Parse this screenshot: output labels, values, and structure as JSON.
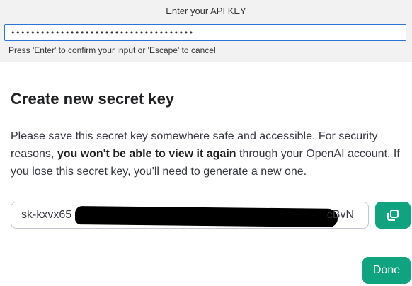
{
  "prompt": {
    "title": "Enter your API KEY",
    "input_value": "•••••••••••••••••••••••••••••••••••••",
    "hint": "Press 'Enter' to confirm your input or 'Escape' to cancel"
  },
  "modal": {
    "title": "Create new secret key",
    "body_before": "Please save this secret key somewhere safe and accessible. For security reasons, ",
    "body_bold": "you won't be able to view it again",
    "body_after": " through your OpenAI account. If you lose this secret key, you'll need to generate a new one.",
    "key_prefix": "sk-kxvx65",
    "key_suffix": "cBvN",
    "copy_icon": "copy-icon",
    "done_label": "Done"
  },
  "colors": {
    "accent": "#10a37f",
    "focus": "#2b73d6"
  }
}
